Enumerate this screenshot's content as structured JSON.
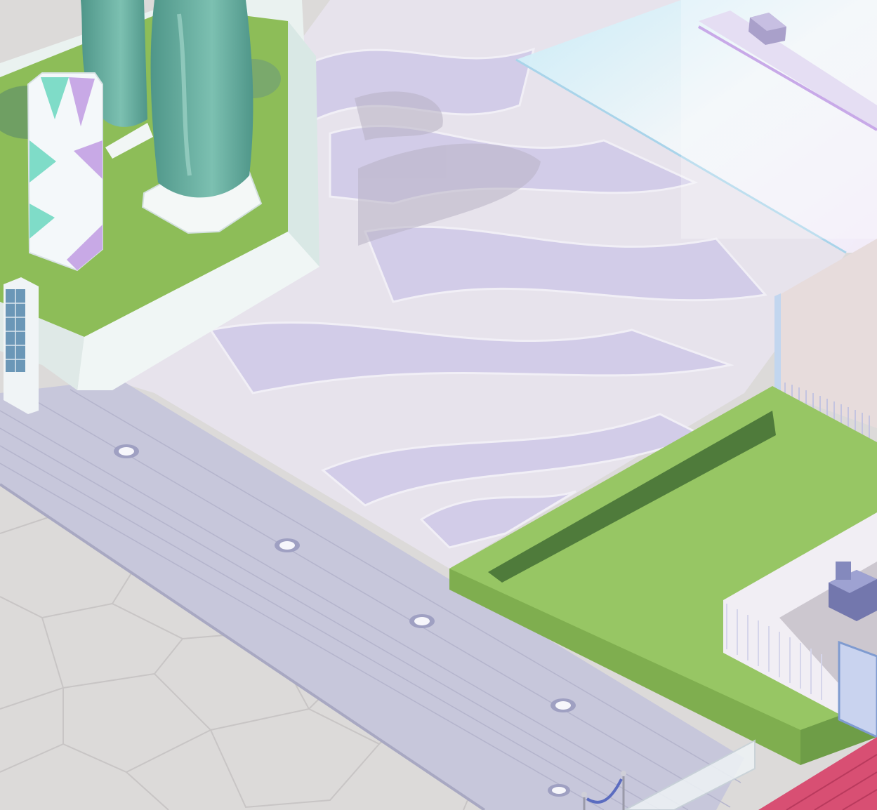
{
  "scene": {
    "kind": "isometric game world (no visible UI text)",
    "palette": {
      "ground_stone": "#dcdad9",
      "stone_lines": "#c9c6c6",
      "plaza_light": "#e8e4ea",
      "plaza_lavender": "#cfc9e6",
      "plaza_wave_line": "#efedf3",
      "walkway": "#c9c9dc",
      "walkway_line": "#b9b9cf",
      "lamp": "#f4f4fa",
      "lamp_ring": "#9e9ec0",
      "grass": "#8fbf5a",
      "grass_dark": "#5e8f3f",
      "hedge": "#4f7a3a",
      "planter_white": "#eef4f2",
      "planter_shadow": "#c5d6d2",
      "tree": "#5fa89a",
      "tree_light": "#8ccfc0",
      "pillar_teal": "#7fdcc8",
      "pillar_purple": "#c8a9e6",
      "glass": "#d6eef6",
      "building_wall": "#e5dada",
      "fence": "#f2f2f8",
      "kiosk": "#7d7fb3",
      "red_carpet": "#d64f73",
      "shadow": "#b7b1c3"
    }
  }
}
